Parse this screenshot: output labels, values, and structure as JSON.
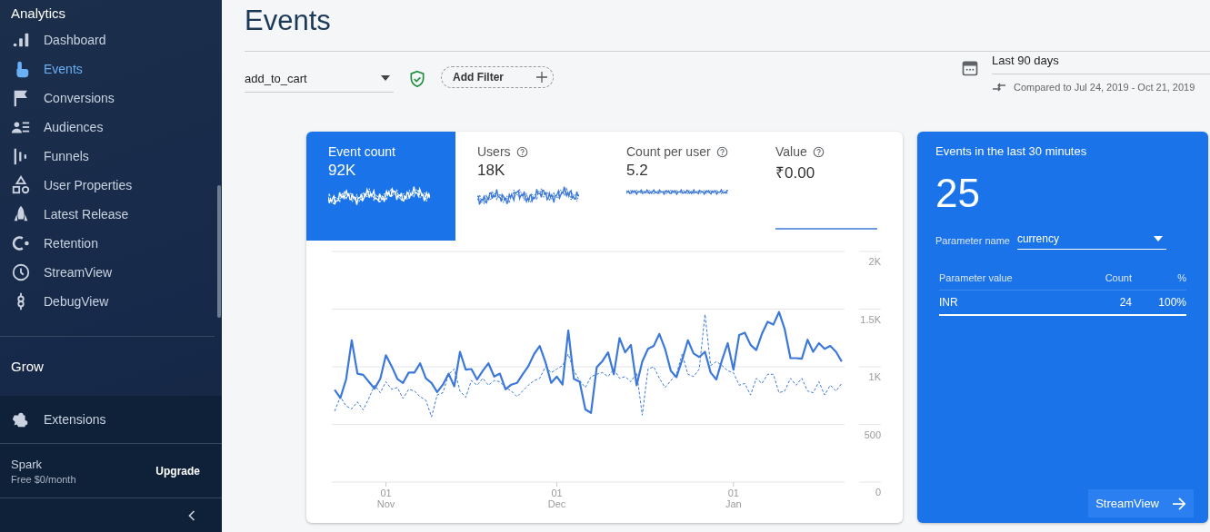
{
  "sidebar": {
    "title": "Analytics",
    "items": [
      {
        "label": "Dashboard",
        "selected": false
      },
      {
        "label": "Events",
        "selected": true
      },
      {
        "label": "Conversions",
        "selected": false
      },
      {
        "label": "Audiences",
        "selected": false
      },
      {
        "label": "Funnels",
        "selected": false
      },
      {
        "label": "User Properties",
        "selected": false
      },
      {
        "label": "Latest Release",
        "selected": false
      },
      {
        "label": "Retention",
        "selected": false
      },
      {
        "label": "StreamView",
        "selected": false
      },
      {
        "label": "DebugView",
        "selected": false
      }
    ],
    "section": "Grow",
    "extensions": "Extensions",
    "plan": {
      "name": "Spark",
      "price": "Free $0/month",
      "action": "Upgrade"
    }
  },
  "page": {
    "title": "Events",
    "event_select": {
      "value": "add_to_cart"
    },
    "add_filter": "Add Filter",
    "date_range": {
      "value": "Last 90 days",
      "comparison": "Compared to Jul 24, 2019 - Oct 21, 2019"
    }
  },
  "metrics": [
    {
      "label": "Event count",
      "value": "92K",
      "selected": true,
      "help": false,
      "kind": "trend"
    },
    {
      "label": "Users",
      "value": "18K",
      "selected": false,
      "help": true,
      "kind": "trend"
    },
    {
      "label": "Count per user",
      "value": "5.2",
      "selected": false,
      "help": true,
      "kind": "steady"
    },
    {
      "label": "Value",
      "value": "₹0.00",
      "selected": false,
      "help": true,
      "kind": "flat"
    }
  ],
  "chart_data": {
    "type": "line",
    "categories": [
      null,
      null,
      null,
      null,
      null,
      null,
      null,
      null,
      null,
      "01 Nov",
      null,
      null,
      null,
      null,
      null,
      null,
      null,
      null,
      null,
      null,
      null,
      null,
      null,
      null,
      null,
      null,
      null,
      null,
      null,
      null,
      null,
      null,
      null,
      null,
      null,
      null,
      null,
      null,
      null,
      "01 Dec",
      null,
      null,
      null,
      null,
      null,
      null,
      null,
      null,
      null,
      null,
      null,
      null,
      null,
      null,
      null,
      null,
      null,
      null,
      null,
      null,
      null,
      null,
      null,
      null,
      null,
      null,
      null,
      null,
      null,
      null,
      "01 Jan",
      null,
      null,
      null,
      null,
      null,
      null,
      null,
      null,
      null,
      null,
      null,
      null,
      null,
      null,
      null,
      null,
      null,
      null,
      null
    ],
    "series": [
      {
        "color": "#3c78d8",
        "line_style": "solid",
        "values": [
          800,
          730,
          890,
          1230,
          940,
          930,
          870,
          810,
          895,
          1100,
          1005,
          895,
          860,
          950,
          950,
          1030,
          900,
          860,
          780,
          845,
          940,
          830,
          1130,
          975,
          980,
          890,
          965,
          1030,
          915,
          940,
          805,
          845,
          860,
          935,
          1005,
          1110,
          1180,
          1040,
          860,
          915,
          845,
          1315,
          895,
          870,
          630,
          600,
          995,
          1050,
          1125,
          935,
          1250,
          1125,
          1190,
          840,
          1045,
          1155,
          1180,
          1285,
          1155,
          965,
          910,
          1060,
          1230,
          1115,
          1085,
          1130,
          950,
          890,
          1060,
          1205,
          975,
          1275,
          1295,
          1190,
          1145,
          1285,
          1390,
          1365,
          1475,
          1325,
          1075,
          1075,
          1070,
          1235,
          1130,
          1205,
          1155,
          1180,
          1130,
          1045
        ]
      },
      {
        "color": "#3c78d8",
        "line_style": "dashed",
        "values": [
          615,
          740,
          660,
          635,
          695,
          625,
          725,
          840,
          775,
          870,
          805,
          820,
          725,
          805,
          790,
          740,
          710,
          565,
          755,
          775,
          935,
          980,
          790,
          735,
          880,
          840,
          900,
          840,
          880,
          870,
          820,
          790,
          740,
          790,
          840,
          880,
          900,
          1000,
          950,
          980,
          1010,
          1110,
          965,
          880,
          820,
          915,
          935,
          950,
          915,
          980,
          900,
          915,
          870,
          950,
          580,
          980,
          1000,
          900,
          820,
          880,
          935,
          1110,
          935,
          915,
          980,
          1455,
          1010,
          1045,
          1010,
          965,
          950,
          840,
          855,
          755,
          900,
          855,
          935,
          935,
          775,
          790,
          900,
          840,
          900,
          790,
          775,
          870,
          755,
          840,
          790,
          855
        ]
      }
    ],
    "grid": true,
    "ylim": [
      0,
      2000
    ],
    "yticks": [
      {
        "value": 0,
        "label": "0"
      },
      {
        "value": 500,
        "label": "500"
      },
      {
        "value": 1000,
        "label": "1K"
      },
      {
        "value": 1500,
        "label": "1.5K"
      },
      {
        "value": 2000,
        "label": "2K"
      }
    ]
  },
  "realtime": {
    "title": "Events in the last 30 minutes",
    "count": "25",
    "parameter_label": "Parameter name",
    "parameter_value": "currency",
    "columns": [
      "Parameter value",
      "Count",
      "%"
    ],
    "rows": [
      [
        "INR",
        "24",
        "100%"
      ]
    ],
    "button": "StreamView"
  }
}
